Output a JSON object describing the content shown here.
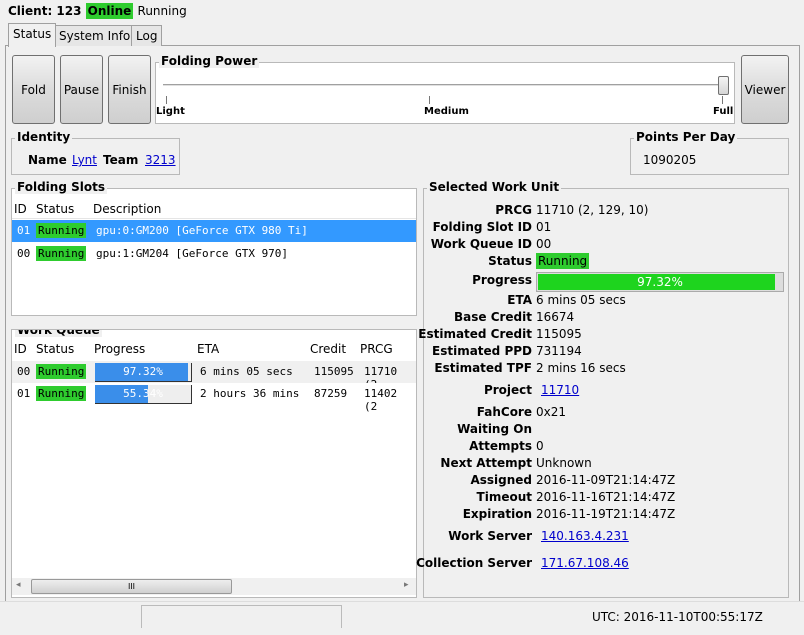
{
  "header": {
    "client_label": "Client: 123",
    "online": "Online",
    "state": "Running"
  },
  "tabs": [
    "Status",
    "System Info",
    "Log"
  ],
  "buttons": {
    "fold": "Fold",
    "pause": "Pause",
    "finish": "Finish",
    "viewer": "Viewer"
  },
  "folding_power": {
    "title": "Folding Power",
    "ticks": [
      "Light",
      "Medium",
      "Full"
    ],
    "level": "Full"
  },
  "identity": {
    "title": "Identity",
    "name_label": "Name",
    "name": "Lynt",
    "team_label": "Team",
    "team": "3213"
  },
  "ppd": {
    "title": "Points Per Day",
    "value": "1090205"
  },
  "folding_slots": {
    "title": "Folding Slots",
    "columns": [
      "ID",
      "Status",
      "Description"
    ],
    "rows": [
      {
        "id": "01",
        "status": "Running",
        "description": "gpu:0:GM200 [GeForce GTX 980 Ti]",
        "selected": true
      },
      {
        "id": "00",
        "status": "Running",
        "description": "gpu:1:GM204 [GeForce GTX 970]",
        "selected": false
      }
    ]
  },
  "work_queue": {
    "title": "Work Queue",
    "columns": [
      "ID",
      "Status",
      "Progress",
      "ETA",
      "Credit",
      "PRCG"
    ],
    "rows": [
      {
        "id": "00",
        "status": "Running",
        "progress": 97.32,
        "progress_text": "97.32%",
        "eta": "6 mins 05 secs",
        "credit": "115095",
        "prcg": "11710 (2"
      },
      {
        "id": "01",
        "status": "Running",
        "progress": 55.34,
        "progress_text": "55.34%",
        "eta": "2 hours 36 mins",
        "credit": "87259",
        "prcg": "11402 (2"
      }
    ],
    "scroll_grip": "III"
  },
  "selected_wu": {
    "title": "Selected Work Unit",
    "prcg_label": "PRCG",
    "prcg": "11710 (2, 129, 10)",
    "slot_label": "Folding Slot ID",
    "slot": "01",
    "wq_label": "Work Queue ID",
    "wq": "00",
    "status_label": "Status",
    "status": "Running",
    "progress_label": "Progress",
    "progress": 97.32,
    "progress_text": "97.32%",
    "eta_label": "ETA",
    "eta": "6 mins 05 secs",
    "base_label": "Base Credit",
    "base": "16674",
    "ecredit_label": "Estimated Credit",
    "ecredit": "115095",
    "eppd_label": "Estimated PPD",
    "eppd": "731194",
    "etpf_label": "Estimated TPF",
    "etpf": "2 mins 16 secs",
    "project_label": "Project",
    "project": "11710",
    "core_label": "FahCore",
    "core": "0x21",
    "waiting_label": "Waiting On",
    "waiting": "",
    "attempts_label": "Attempts",
    "attempts": "0",
    "next_label": "Next Attempt",
    "next": "Unknown",
    "assigned_label": "Assigned",
    "assigned": "2016-11-09T21:14:47Z",
    "timeout_label": "Timeout",
    "timeout": "2016-11-16T21:14:47Z",
    "expiration_label": "Expiration",
    "expiration": "2016-11-19T21:14:47Z",
    "ws_label": "Work Server",
    "ws": "140.163.4.231",
    "cs_label": "Collection Server",
    "cs": "171.67.108.46"
  },
  "statusbar": {
    "utc": "UTC: 2016-11-10T00:55:17Z"
  },
  "colors": {
    "running": "#2ecc2e",
    "selection": "#3399ff",
    "progress_blue": "#3a8eea",
    "progress_green": "#1ed41e"
  }
}
